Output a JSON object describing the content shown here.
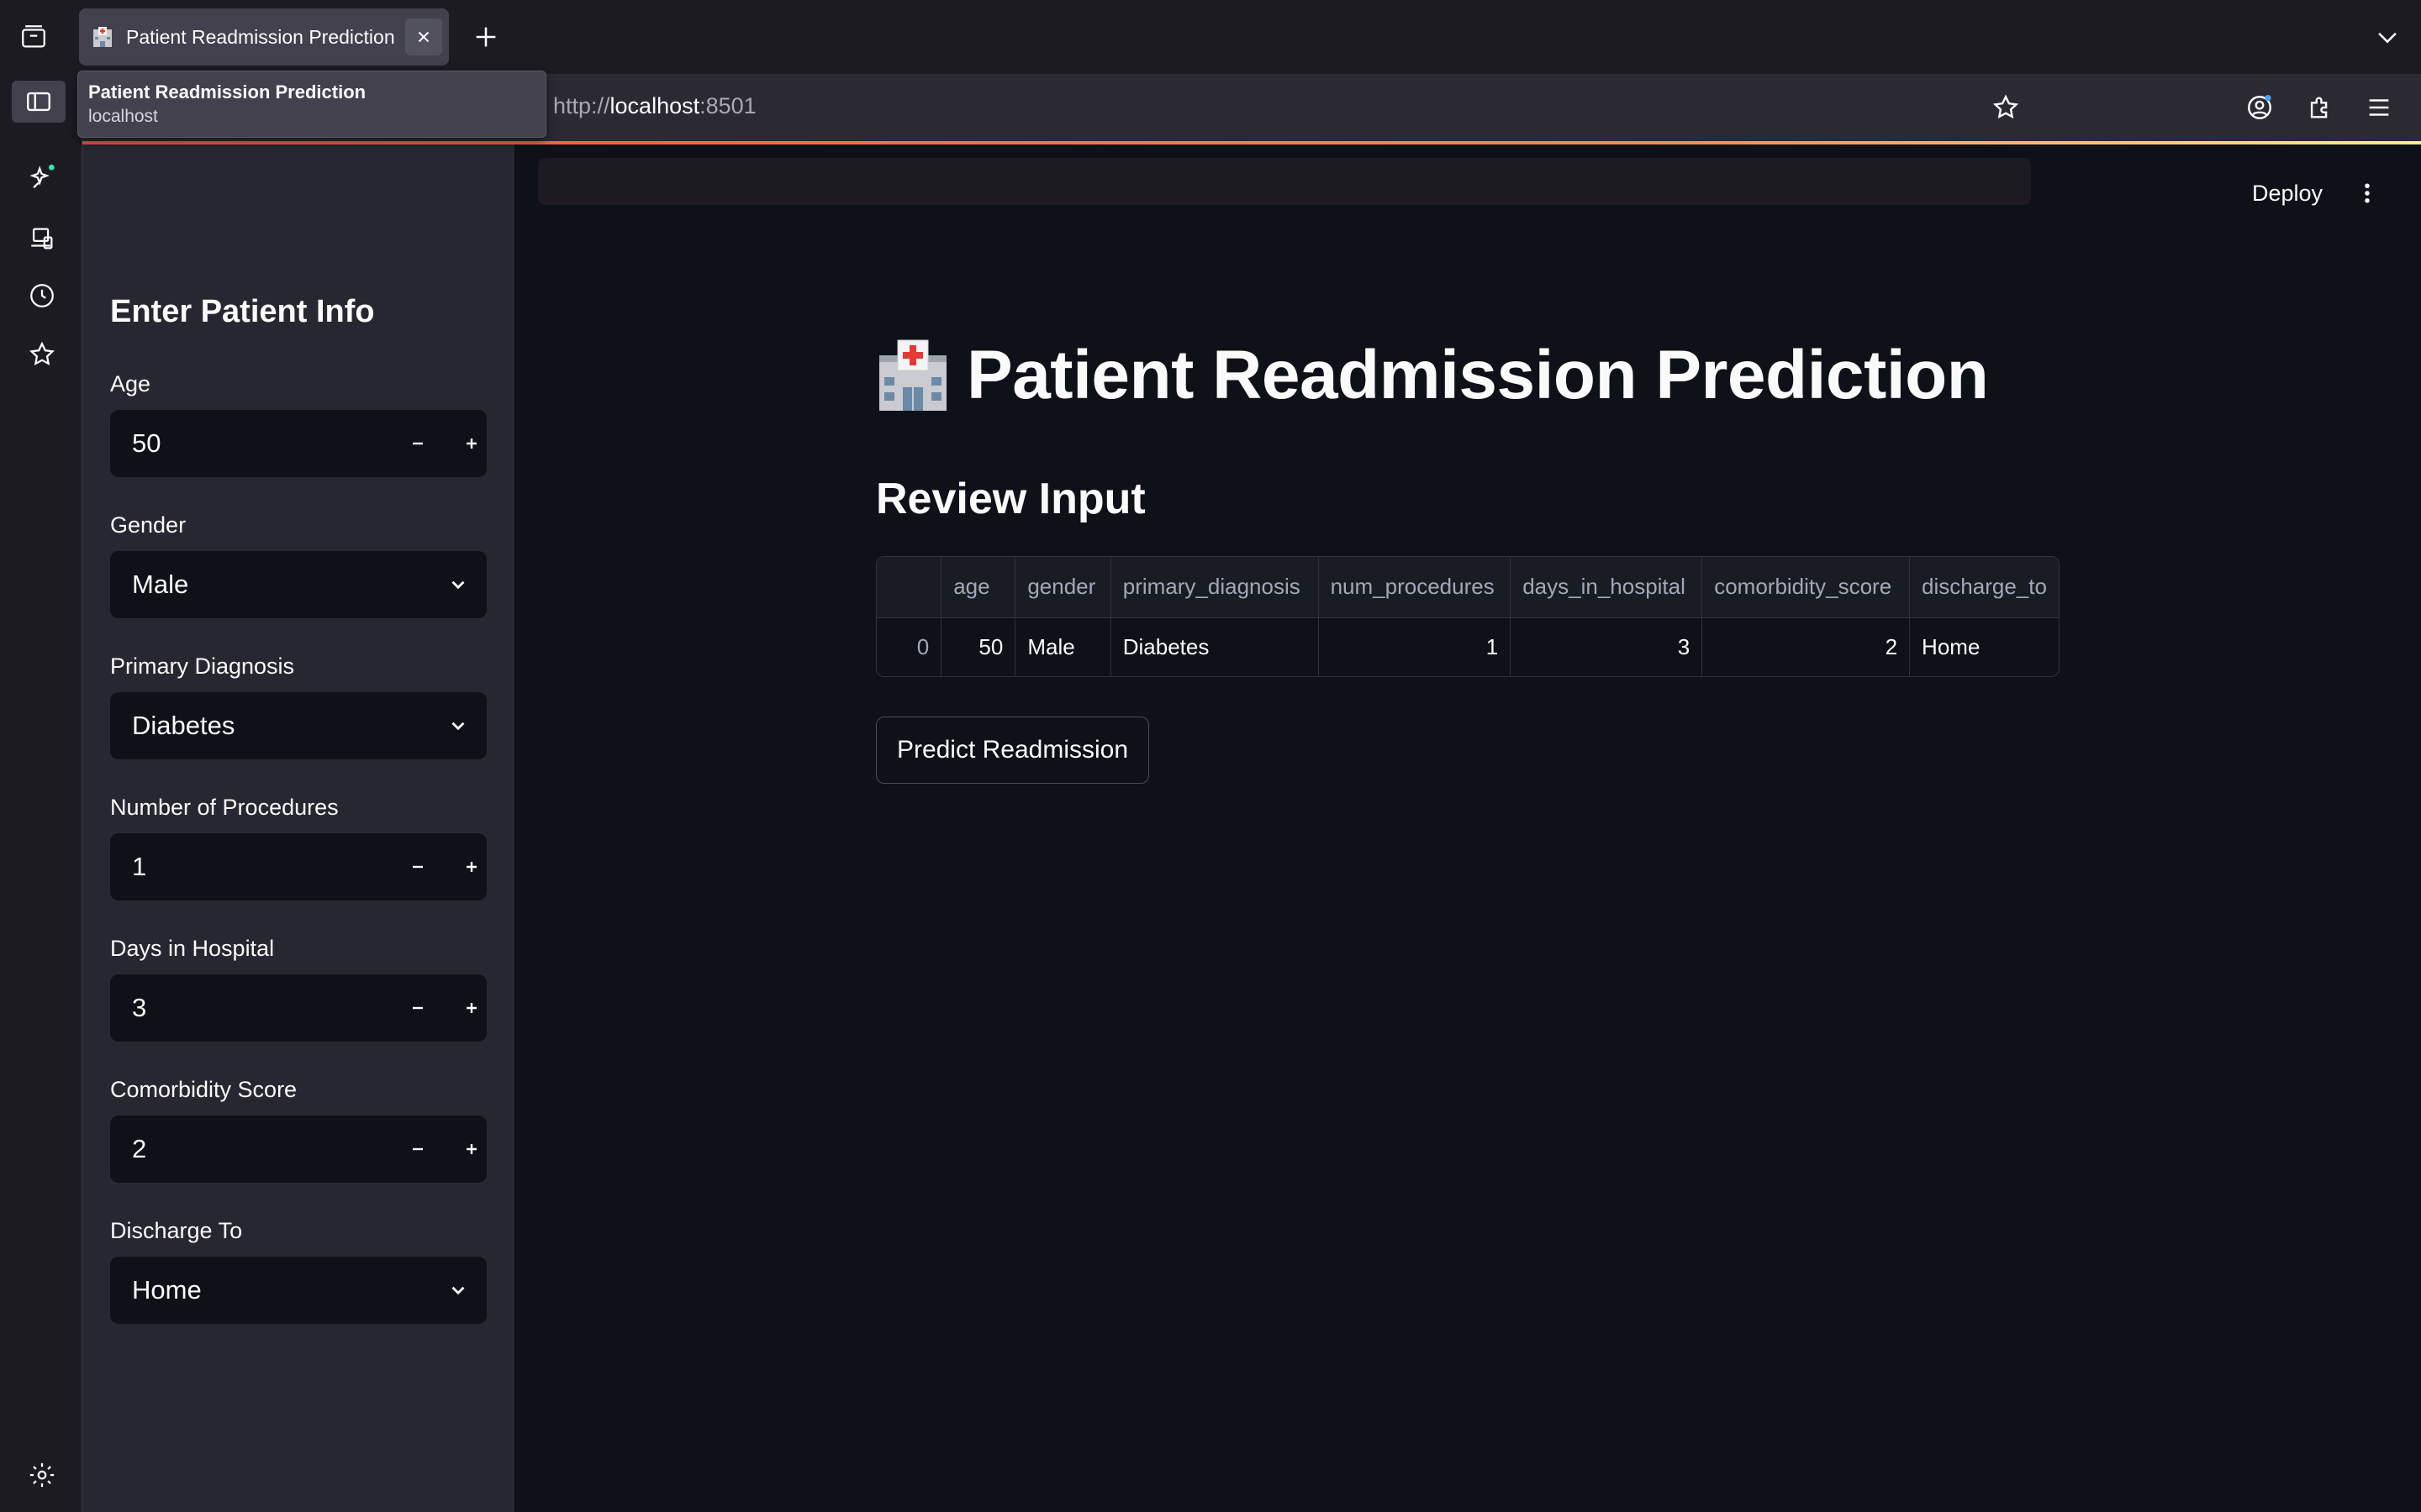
{
  "browser": {
    "tab_title": "Patient Readmission Prediction",
    "url_scheme": "http://",
    "url_host": "localhost",
    "url_port": ":8501",
    "tooltip_title": "Patient Readmission Prediction",
    "tooltip_host": "localhost"
  },
  "sidebar": {
    "header": "Enter Patient Info",
    "fields": [
      {
        "label": "Age",
        "value": "50",
        "type": "number"
      },
      {
        "label": "Gender",
        "value": "Male",
        "type": "select"
      },
      {
        "label": "Primary Diagnosis",
        "value": "Diabetes",
        "type": "select"
      },
      {
        "label": "Number of Procedures",
        "value": "1",
        "type": "number"
      },
      {
        "label": "Days in Hospital",
        "value": "3",
        "type": "number"
      },
      {
        "label": "Comorbidity Score",
        "value": "2",
        "type": "number"
      },
      {
        "label": "Discharge To",
        "value": "Home",
        "type": "select"
      }
    ]
  },
  "header": {
    "deploy_label": "Deploy"
  },
  "main": {
    "title": "Patient Readmission Prediction",
    "title_icon": "hospital-emoji",
    "section_title": "Review Input",
    "table": {
      "columns": [
        "",
        "age",
        "gender",
        "primary_diagnosis",
        "num_procedures",
        "days_in_hospital",
        "comorbidity_score",
        "discharge_to"
      ],
      "rows": [
        [
          "0",
          "50",
          "Male",
          "Diabetes",
          "1",
          "3",
          "2",
          "Home"
        ]
      ]
    },
    "button_label": "Predict Readmission"
  },
  "colors": {
    "background": "#0e1117",
    "sidebar": "#262730",
    "accent": "#ff4b4b"
  }
}
